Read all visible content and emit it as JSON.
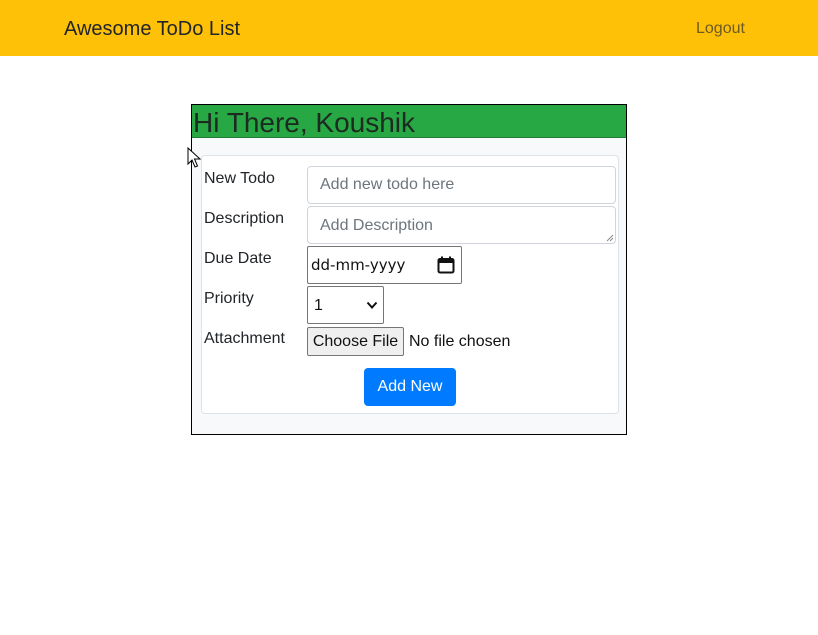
{
  "navbar": {
    "brand": "Awesome ToDo List",
    "logout": "Logout"
  },
  "card": {
    "greeting": "Hi There, Koushik"
  },
  "form": {
    "new_todo_label": "New Todo",
    "new_todo_placeholder": "Add new todo here",
    "description_label": "Description",
    "description_placeholder": "Add Description",
    "due_date_label": "Due Date",
    "due_date_value": "dd-mm-yyyy",
    "priority_label": "Priority",
    "priority_value": "1",
    "attachment_label": "Attachment",
    "choose_file_label": "Choose File",
    "file_status": "No file chosen",
    "submit_label": "Add New"
  },
  "colors": {
    "navbar_bg": "#ffc107",
    "greeting_bg": "#28a745",
    "primary_button": "#007bff"
  },
  "icons": {
    "calendar": "calendar-icon",
    "select_arrow": "chevron-down-icon",
    "cursor": "mouse-pointer-icon"
  }
}
